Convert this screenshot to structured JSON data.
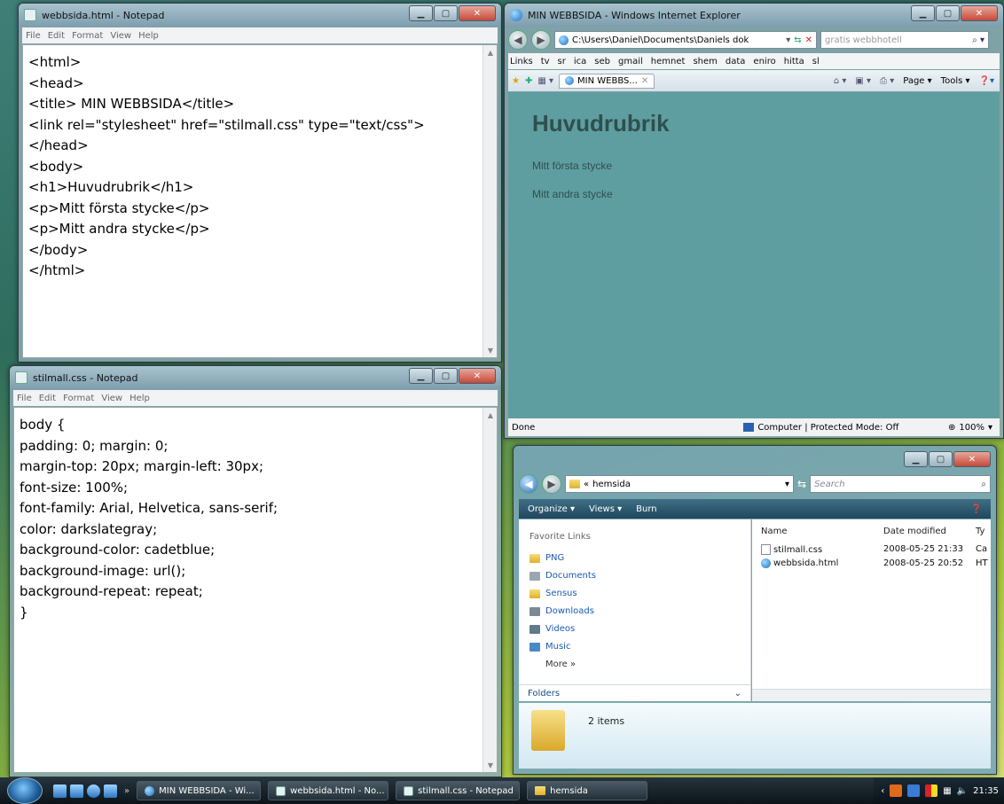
{
  "notepad_html": {
    "title": "webbsida.html - Notepad",
    "menu": [
      "File",
      "Edit",
      "Format",
      "View",
      "Help"
    ],
    "lines": [
      "<html>",
      "<head>",
      "<title> MIN WEBBSIDA</title>",
      "<link rel=\"stylesheet\" href=\"stilmall.css\" type=\"text/css\">",
      "</head>",
      "<body>",
      "<h1>Huvudrubrik</h1>",
      "<p>Mitt första stycke</p>",
      "<p>Mitt andra stycke</p>",
      "</body>",
      "</html>"
    ]
  },
  "notepad_css": {
    "title": "stilmall.css - Notepad",
    "menu": [
      "File",
      "Edit",
      "Format",
      "View",
      "Help"
    ],
    "lines": [
      "body {",
      "padding: 0; margin: 0;",
      "margin-top: 20px; margin-left: 30px;",
      "font-size: 100%;",
      "font-family: Arial, Helvetica, sans-serif;",
      "color: darkslategray;",
      "background-color: cadetblue;",
      "background-image: url();",
      "background-repeat: repeat;",
      "}"
    ]
  },
  "ie": {
    "title": "MIN WEBBSIDA - Windows Internet Explorer",
    "address": "C:\\Users\\Daniel\\Documents\\Daniels dok",
    "search_placeholder": "gratis webbhotell",
    "links": [
      "Links",
      "tv",
      "sr",
      "ica",
      "seb",
      "gmail",
      "hemnet",
      "shem",
      "data",
      "eniro",
      "hitta",
      "sl"
    ],
    "tab_label": "MIN WEBBS...",
    "tools": [
      "Page ▾",
      "Tools ▾"
    ],
    "page": {
      "h1": "Huvudrubrik",
      "p1": "Mitt första stycke",
      "p2": "Mitt andra stycke"
    },
    "status": "Done",
    "zone": "Computer | Protected Mode: Off",
    "zoom": "100%"
  },
  "explorer": {
    "path_prefix": "«",
    "path": "hemsida",
    "search_placeholder": "Search",
    "commands": [
      "Organize ▾",
      "Views ▾",
      "Burn"
    ],
    "favorite_links_title": "Favorite Links",
    "favorites": [
      "PNG",
      "Documents",
      "Sensus",
      "Downloads",
      "Videos",
      "Music"
    ],
    "more": "More »",
    "folders": "Folders",
    "columns": [
      "Name",
      "Date modified",
      "Ty"
    ],
    "files": [
      {
        "name": "stilmall.css",
        "date": "2008-05-25 21:33",
        "type": "Ca"
      },
      {
        "name": "webbsida.html",
        "date": "2008-05-25 20:52",
        "type": "HT"
      }
    ],
    "item_count": "2 items"
  },
  "taskbar": {
    "buttons": [
      "MIN WEBBSIDA - Wi...",
      "webbsida.html - No...",
      "stilmall.css - Notepad",
      "hemsida"
    ],
    "time": "21:35"
  }
}
